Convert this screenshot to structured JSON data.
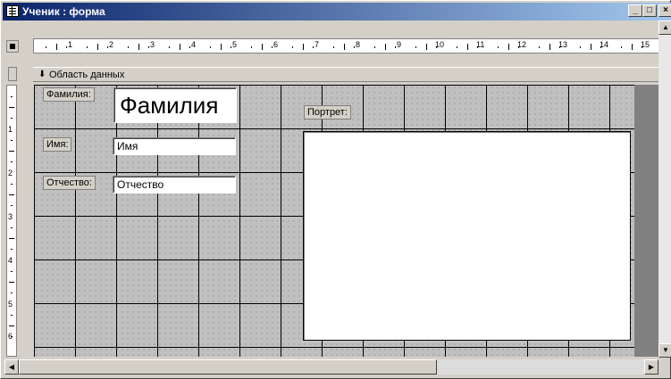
{
  "window": {
    "title": "Ученик : форма",
    "controls": {
      "minimize": "_",
      "maximize": "□",
      "close": "×"
    }
  },
  "ruler": {
    "labels": [
      "1",
      "2",
      "3",
      "4",
      "5",
      "6",
      "7",
      "8",
      "9",
      "10",
      "11",
      "12",
      "13",
      "14",
      "15"
    ],
    "vertical_labels": [
      "1",
      "2",
      "3",
      "4",
      "5",
      "6"
    ]
  },
  "section": {
    "arrow": "⬇",
    "label": "Область данных"
  },
  "form": {
    "surname_label": "Фамилия:",
    "surname_value": "Фамилия",
    "name_label": "Имя:",
    "name_value": "Имя",
    "patronymic_label": "Отчество:",
    "patronymic_value": "Отчество",
    "portrait_label": "Портрет:"
  },
  "icons": {
    "app": "form-icon",
    "section_arrow": "down-arrow-icon",
    "scroll_up": "▲",
    "scroll_down": "▼",
    "scroll_left": "◀",
    "scroll_right": "▶"
  },
  "colors": {
    "titlebar_start": "#0a246a",
    "titlebar_end": "#a6caf0",
    "face": "#d4d0c8",
    "canvas": "#808080",
    "grid": "#c0c0c0"
  }
}
